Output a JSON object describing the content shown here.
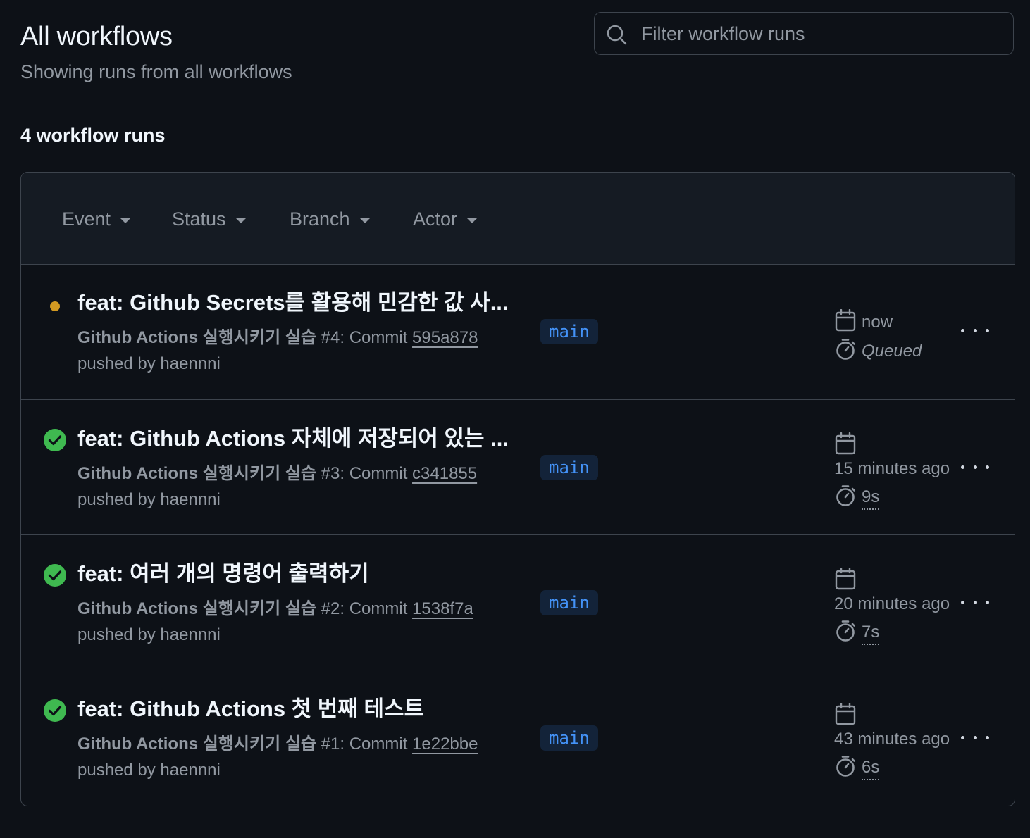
{
  "header": {
    "title": "All workflows",
    "subtitle": "Showing runs from all workflows"
  },
  "search": {
    "placeholder": "Filter workflow runs",
    "icon": "search-icon"
  },
  "runs_count": "4 workflow runs",
  "filters": [
    "Event",
    "Status",
    "Branch",
    "Actor"
  ],
  "runs": [
    {
      "status": "queued",
      "title": "feat: Github Secrets를 활용해 민감한 값 사...",
      "workflow": "Github Actions 실행시키기 실습",
      "meta": " #4: Commit ",
      "commit": "595a878",
      "actor": "pushed by haennni",
      "branch": "main",
      "time": "now",
      "duration": "Queued"
    },
    {
      "status": "success",
      "title": "feat: Github Actions 자체에 저장되어 있는 ...",
      "workflow": "Github Actions 실행시키기 실습",
      "meta": " #3: Commit ",
      "commit": "c341855",
      "actor": "pushed by haennni",
      "branch": "main",
      "time": "15 minutes ago",
      "duration": "9s"
    },
    {
      "status": "success",
      "title": "feat: 여러 개의 명령어 출력하기",
      "workflow": "Github Actions 실행시키기 실습",
      "meta": " #2: Commit ",
      "commit": "1538f7a",
      "actor": "pushed by haennni",
      "branch": "main",
      "time": "20 minutes ago",
      "duration": "7s"
    },
    {
      "status": "success",
      "title": "feat: Github Actions 첫 번째 테스트",
      "workflow": "Github Actions 실행시키기 실습",
      "meta": " #1: Commit ",
      "commit": "1e22bbe",
      "actor": "pushed by haennni",
      "branch": "main",
      "time": "43 minutes ago",
      "duration": "6s"
    }
  ],
  "colors": {
    "background": "#0d1117",
    "queued": "#d29922",
    "success": "#3fb950",
    "branch_bg": "#132339",
    "branch_fg": "#4493f8",
    "border": "#3d444d"
  }
}
